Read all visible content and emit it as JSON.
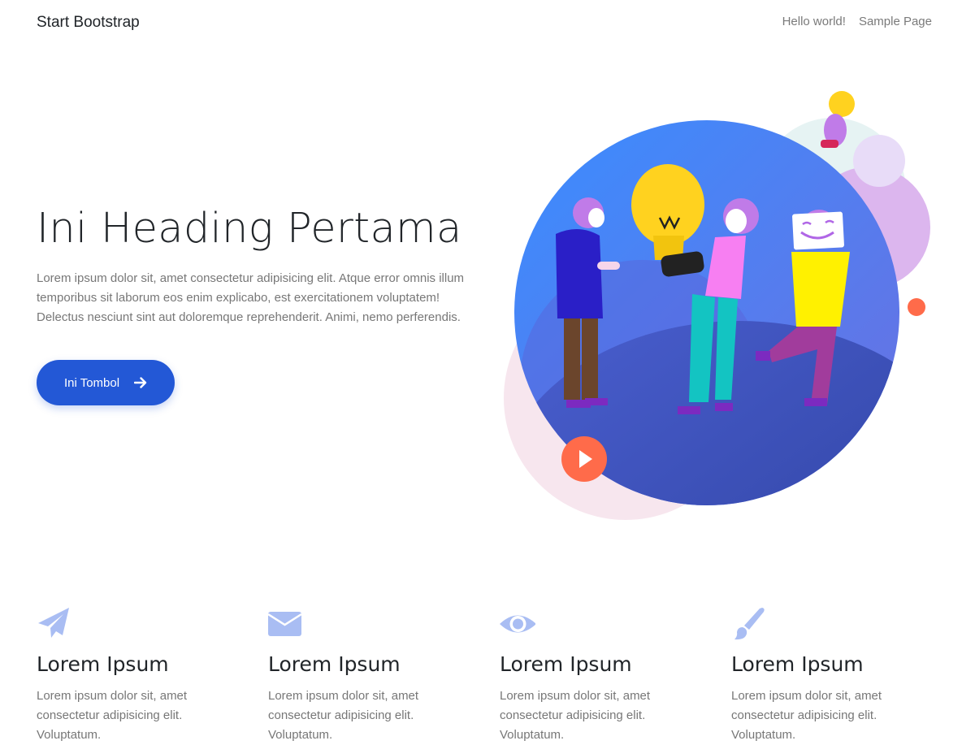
{
  "navbar": {
    "brand": "Start Bootstrap",
    "links": [
      "Hello world!",
      "Sample Page"
    ]
  },
  "hero": {
    "title": "Ini Heading Pertama",
    "text": "Lorem ipsum dolor sit, amet consectetur adipisicing elit. Atque error omnis illum temporibus sit laborum eos enim explicabo, est exercitationem voluptatem! Delectus nesciunt sint aut doloremque reprehenderit. Animi, nemo perferendis.",
    "button_label": "Ini Tombol",
    "button_icon": "arrow-right-icon"
  },
  "illustration": {
    "icon": "play-icon"
  },
  "features": [
    {
      "icon": "paper-plane-icon",
      "title": "Lorem Ipsum",
      "text": "Lorem ipsum dolor sit, amet consectetur adipisicing elit. Voluptatum."
    },
    {
      "icon": "envelope-icon",
      "title": "Lorem Ipsum",
      "text": "Lorem ipsum dolor sit, amet consectetur adipisicing elit. Voluptatum."
    },
    {
      "icon": "eye-icon",
      "title": "Lorem Ipsum",
      "text": "Lorem ipsum dolor sit, amet consectetur adipisicing elit. Voluptatum."
    },
    {
      "icon": "paint-brush-icon",
      "title": "Lorem Ipsum",
      "text": "Lorem ipsum dolor sit, amet consectetur adipisicing elit. Voluptatum."
    }
  ],
  "colors": {
    "accent": "#2358d6",
    "icon": "#a9bdf3",
    "play": "#ff6b4a",
    "text_muted": "#777777"
  }
}
